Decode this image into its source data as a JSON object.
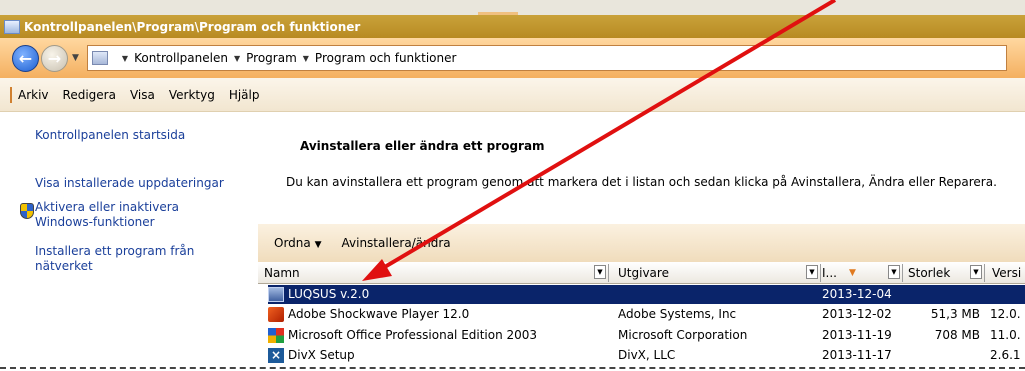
{
  "window": {
    "title": "Kontrollpanelen\\Program\\Program och funktioner"
  },
  "address": {
    "crumbs": [
      "Kontrollpanelen",
      "Program",
      "Program och funktioner"
    ]
  },
  "menu": [
    "Arkiv",
    "Redigera",
    "Visa",
    "Verktyg",
    "Hjälp"
  ],
  "sidebar": {
    "links": [
      "Kontrollpanelen startsida",
      "Visa installerade uppdateringar",
      "Aktivera eller inaktivera",
      "Windows-funktioner",
      "Installera ett program från",
      "nätverket"
    ]
  },
  "main": {
    "heading": "Avinstallera eller ändra ett program",
    "description": "Du kan avinstallera ett program genom att markera det i listan och sedan klicka på Avinstallera, Ändra eller Reparera."
  },
  "toolbar": {
    "organize": "Ordna",
    "uninstall": "Avinstallera/ändra"
  },
  "columns": {
    "name": "Namn",
    "publisher": "Utgivare",
    "installed": "I...",
    "size": "Storlek",
    "version": "Versi"
  },
  "rows": [
    {
      "name": "LUQSUS v.2.0",
      "publisher": "",
      "date": "2013-12-04",
      "size": "",
      "version": "",
      "icon": "luqsus-icon"
    },
    {
      "name": "Adobe Shockwave Player 12.0",
      "publisher": "Adobe Systems, Inc",
      "date": "2013-12-02",
      "size": "51,3 MB",
      "version": "12.0.",
      "icon": "shockwave-icon"
    },
    {
      "name": "Microsoft Office Professional Edition 2003",
      "publisher": "Microsoft Corporation",
      "date": "2013-11-19",
      "size": "708 MB",
      "version": "11.0.",
      "icon": "office-icon"
    },
    {
      "name": "DivX Setup",
      "publisher": "DivX, LLC",
      "date": "2013-11-17",
      "size": "",
      "version": "2.6.1",
      "icon": "divx-icon"
    }
  ],
  "colors": {
    "title_bar": "#c39a30",
    "selection": "#0a246a",
    "link": "#1a3f9a",
    "arrow": "#e01010"
  }
}
